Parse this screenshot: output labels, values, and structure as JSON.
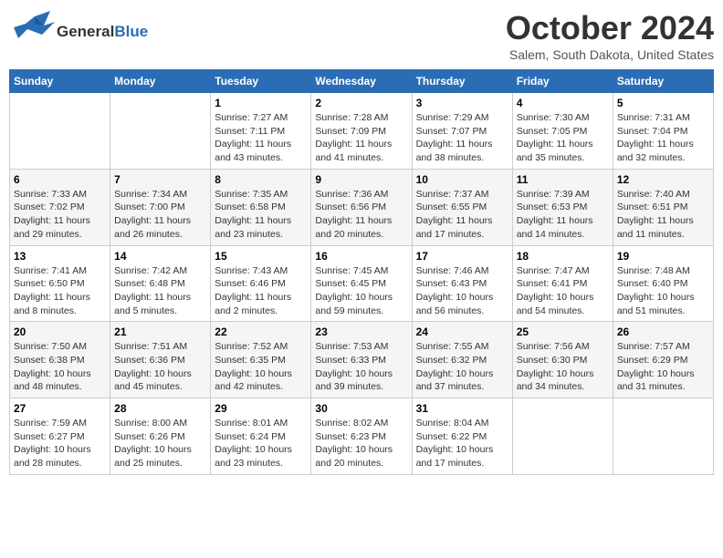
{
  "logo": {
    "general": "General",
    "blue": "Blue"
  },
  "header": {
    "month": "October 2024",
    "location": "Salem, South Dakota, United States"
  },
  "weekdays": [
    "Sunday",
    "Monday",
    "Tuesday",
    "Wednesday",
    "Thursday",
    "Friday",
    "Saturday"
  ],
  "weeks": [
    [
      {
        "day": "",
        "sunrise": "",
        "sunset": "",
        "daylight": ""
      },
      {
        "day": "",
        "sunrise": "",
        "sunset": "",
        "daylight": ""
      },
      {
        "day": "1",
        "sunrise": "Sunrise: 7:27 AM",
        "sunset": "Sunset: 7:11 PM",
        "daylight": "Daylight: 11 hours and 43 minutes."
      },
      {
        "day": "2",
        "sunrise": "Sunrise: 7:28 AM",
        "sunset": "Sunset: 7:09 PM",
        "daylight": "Daylight: 11 hours and 41 minutes."
      },
      {
        "day": "3",
        "sunrise": "Sunrise: 7:29 AM",
        "sunset": "Sunset: 7:07 PM",
        "daylight": "Daylight: 11 hours and 38 minutes."
      },
      {
        "day": "4",
        "sunrise": "Sunrise: 7:30 AM",
        "sunset": "Sunset: 7:05 PM",
        "daylight": "Daylight: 11 hours and 35 minutes."
      },
      {
        "day": "5",
        "sunrise": "Sunrise: 7:31 AM",
        "sunset": "Sunset: 7:04 PM",
        "daylight": "Daylight: 11 hours and 32 minutes."
      }
    ],
    [
      {
        "day": "6",
        "sunrise": "Sunrise: 7:33 AM",
        "sunset": "Sunset: 7:02 PM",
        "daylight": "Daylight: 11 hours and 29 minutes."
      },
      {
        "day": "7",
        "sunrise": "Sunrise: 7:34 AM",
        "sunset": "Sunset: 7:00 PM",
        "daylight": "Daylight: 11 hours and 26 minutes."
      },
      {
        "day": "8",
        "sunrise": "Sunrise: 7:35 AM",
        "sunset": "Sunset: 6:58 PM",
        "daylight": "Daylight: 11 hours and 23 minutes."
      },
      {
        "day": "9",
        "sunrise": "Sunrise: 7:36 AM",
        "sunset": "Sunset: 6:56 PM",
        "daylight": "Daylight: 11 hours and 20 minutes."
      },
      {
        "day": "10",
        "sunrise": "Sunrise: 7:37 AM",
        "sunset": "Sunset: 6:55 PM",
        "daylight": "Daylight: 11 hours and 17 minutes."
      },
      {
        "day": "11",
        "sunrise": "Sunrise: 7:39 AM",
        "sunset": "Sunset: 6:53 PM",
        "daylight": "Daylight: 11 hours and 14 minutes."
      },
      {
        "day": "12",
        "sunrise": "Sunrise: 7:40 AM",
        "sunset": "Sunset: 6:51 PM",
        "daylight": "Daylight: 11 hours and 11 minutes."
      }
    ],
    [
      {
        "day": "13",
        "sunrise": "Sunrise: 7:41 AM",
        "sunset": "Sunset: 6:50 PM",
        "daylight": "Daylight: 11 hours and 8 minutes."
      },
      {
        "day": "14",
        "sunrise": "Sunrise: 7:42 AM",
        "sunset": "Sunset: 6:48 PM",
        "daylight": "Daylight: 11 hours and 5 minutes."
      },
      {
        "day": "15",
        "sunrise": "Sunrise: 7:43 AM",
        "sunset": "Sunset: 6:46 PM",
        "daylight": "Daylight: 11 hours and 2 minutes."
      },
      {
        "day": "16",
        "sunrise": "Sunrise: 7:45 AM",
        "sunset": "Sunset: 6:45 PM",
        "daylight": "Daylight: 10 hours and 59 minutes."
      },
      {
        "day": "17",
        "sunrise": "Sunrise: 7:46 AM",
        "sunset": "Sunset: 6:43 PM",
        "daylight": "Daylight: 10 hours and 56 minutes."
      },
      {
        "day": "18",
        "sunrise": "Sunrise: 7:47 AM",
        "sunset": "Sunset: 6:41 PM",
        "daylight": "Daylight: 10 hours and 54 minutes."
      },
      {
        "day": "19",
        "sunrise": "Sunrise: 7:48 AM",
        "sunset": "Sunset: 6:40 PM",
        "daylight": "Daylight: 10 hours and 51 minutes."
      }
    ],
    [
      {
        "day": "20",
        "sunrise": "Sunrise: 7:50 AM",
        "sunset": "Sunset: 6:38 PM",
        "daylight": "Daylight: 10 hours and 48 minutes."
      },
      {
        "day": "21",
        "sunrise": "Sunrise: 7:51 AM",
        "sunset": "Sunset: 6:36 PM",
        "daylight": "Daylight: 10 hours and 45 minutes."
      },
      {
        "day": "22",
        "sunrise": "Sunrise: 7:52 AM",
        "sunset": "Sunset: 6:35 PM",
        "daylight": "Daylight: 10 hours and 42 minutes."
      },
      {
        "day": "23",
        "sunrise": "Sunrise: 7:53 AM",
        "sunset": "Sunset: 6:33 PM",
        "daylight": "Daylight: 10 hours and 39 minutes."
      },
      {
        "day": "24",
        "sunrise": "Sunrise: 7:55 AM",
        "sunset": "Sunset: 6:32 PM",
        "daylight": "Daylight: 10 hours and 37 minutes."
      },
      {
        "day": "25",
        "sunrise": "Sunrise: 7:56 AM",
        "sunset": "Sunset: 6:30 PM",
        "daylight": "Daylight: 10 hours and 34 minutes."
      },
      {
        "day": "26",
        "sunrise": "Sunrise: 7:57 AM",
        "sunset": "Sunset: 6:29 PM",
        "daylight": "Daylight: 10 hours and 31 minutes."
      }
    ],
    [
      {
        "day": "27",
        "sunrise": "Sunrise: 7:59 AM",
        "sunset": "Sunset: 6:27 PM",
        "daylight": "Daylight: 10 hours and 28 minutes."
      },
      {
        "day": "28",
        "sunrise": "Sunrise: 8:00 AM",
        "sunset": "Sunset: 6:26 PM",
        "daylight": "Daylight: 10 hours and 25 minutes."
      },
      {
        "day": "29",
        "sunrise": "Sunrise: 8:01 AM",
        "sunset": "Sunset: 6:24 PM",
        "daylight": "Daylight: 10 hours and 23 minutes."
      },
      {
        "day": "30",
        "sunrise": "Sunrise: 8:02 AM",
        "sunset": "Sunset: 6:23 PM",
        "daylight": "Daylight: 10 hours and 20 minutes."
      },
      {
        "day": "31",
        "sunrise": "Sunrise: 8:04 AM",
        "sunset": "Sunset: 6:22 PM",
        "daylight": "Daylight: 10 hours and 17 minutes."
      },
      {
        "day": "",
        "sunrise": "",
        "sunset": "",
        "daylight": ""
      },
      {
        "day": "",
        "sunrise": "",
        "sunset": "",
        "daylight": ""
      }
    ]
  ]
}
